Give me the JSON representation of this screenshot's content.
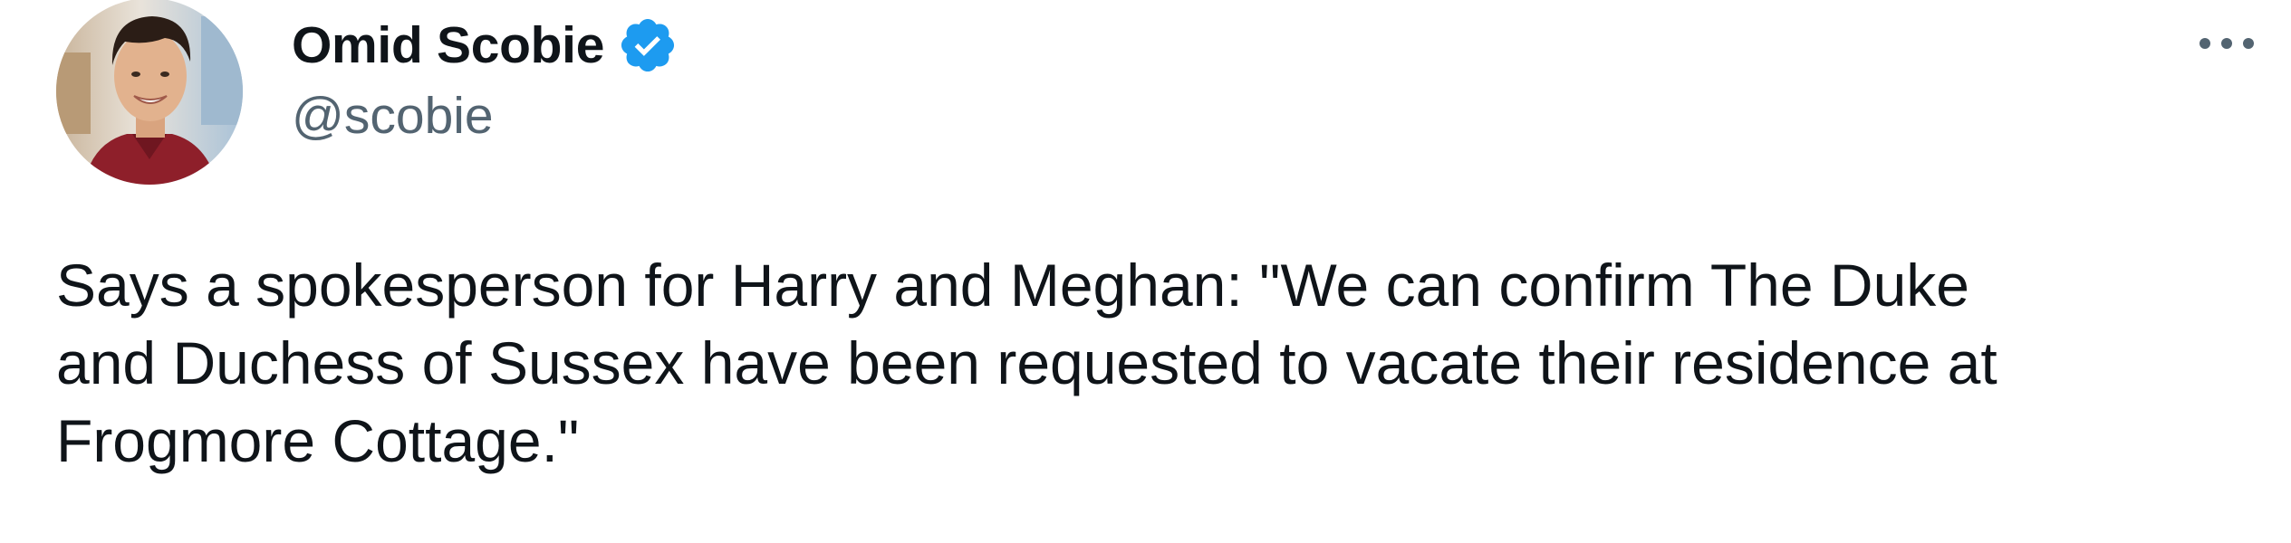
{
  "tweet": {
    "author": {
      "display_name": "Omid Scobie",
      "handle": "@scobie",
      "verified": true,
      "avatar_icon": "profile-photo"
    },
    "more_icon": "more-options-icon",
    "text": "Says a spokesperson for Harry and Meghan: \"We can confirm The Duke\nand Duchess of Sussex have been requested to vacate their residence at\nFrogmore Cottage.\""
  },
  "colors": {
    "text": "#0f1419",
    "secondary_text": "#536471",
    "verified_badge": "#1d9bf0",
    "background": "#ffffff"
  }
}
